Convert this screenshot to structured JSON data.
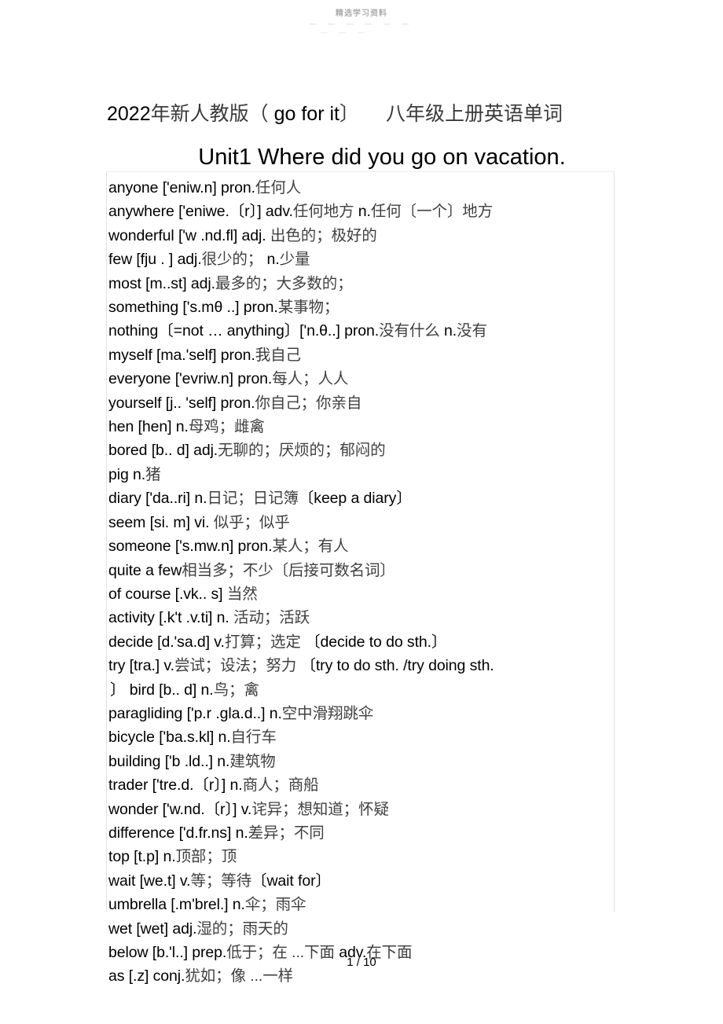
{
  "watermark": {
    "text": "精选学习资料",
    "dashes_row1": "—  —  —  —  —  —",
    "dashes_row2": "—  —  —"
  },
  "heading": {
    "title_prefix": "2022",
    "title_cn_1": "年新人教版（",
    "title_en": " go for it",
    "title_cn_2": "〕",
    "title_cn_3": "八年级上册英语单词",
    "unit_title": "Unit1  Where did you go on vacation."
  },
  "vocabulary": [
    {
      "en": "anyone ['eniw.n] pron.",
      "cn": "任何人"
    },
    {
      "en": "anywhere ['eniwe.〔r〕] adv.",
      "cn": "任何地方",
      "en2": " n.",
      "cn2": "任何〔一个〕地方"
    },
    {
      "en": "wonderful ['w .nd.fl] adj. ",
      "cn": "出色的；极好的"
    },
    {
      "en": "few [fju . ] adj.",
      "cn": "很少的；",
      "en2": " n.",
      "cn2": "少量"
    },
    {
      "en": "most [m..st] adj.",
      "cn": "最多的；大多数的；"
    },
    {
      "en": "something ['s.mθ ..] pron.",
      "cn": "某事物；"
    },
    {
      "en": "nothing〔=not … anything〕['n.θ..]   pron.",
      "cn": "没有什么",
      "en2": " n.",
      "cn2": "没有"
    },
    {
      "en": "myself [ma.'self] pron.",
      "cn": "我自己"
    },
    {
      "en": "everyone ['evriw.n] pron.",
      "cn": "每人；人人"
    },
    {
      "en": "yourself [j.. 'self] pron.",
      "cn": "你自己；你亲自"
    },
    {
      "en": "hen [hen] n.",
      "cn": "母鸡；雌禽"
    },
    {
      "en": "bored [b.. d] adj.",
      "cn": "无聊的；厌烦的；郁闷的"
    },
    {
      "en": "pig n.",
      "cn": "猪"
    },
    {
      "en": "diary ['da..ri] n.",
      "cn": "日记；日记簿",
      "en2": "〔keep a diary〕"
    },
    {
      "en": "seem [si. m] vi. ",
      "cn": "似乎；似乎"
    },
    {
      "en": "someone ['s.mw.n] pron.",
      "cn": "某人；有人"
    },
    {
      "en": "quite a few",
      "cn": "相当多；不少〔后接可数名词〕"
    },
    {
      "en": "of course [.vk.. s] ",
      "cn": "当然"
    },
    {
      "en": "activity [.k't .v.ti] n. ",
      "cn": "活动；活跃"
    },
    {
      "en": "decide [d.'sa.d] v.",
      "cn": "打算；选定",
      "en2": " 〔decide to do sth.〕"
    },
    {
      "en": "try [tra.] v.",
      "cn": "尝试；设法；努力",
      "en2": "  〔try to do sth. /try doing sth."
    },
    {
      "en": "〕 bird [b.. d] n.",
      "cn": "鸟；禽",
      "indent": true
    },
    {
      "en": "paragliding ['p.r .gla.d..] n.",
      "cn": "空中滑翔跳伞"
    },
    {
      "en": "bicycle ['ba.s.kl] n.",
      "cn": "自行车"
    },
    {
      "en": "building ['b .ld..] n.",
      "cn": "建筑物"
    },
    {
      "en": "trader ['tre.d.〔r〕] n.",
      "cn": "商人；商船"
    },
    {
      "en": "wonder ['w.nd.〔r〕] v.",
      "cn": "诧异；想知道；怀疑"
    },
    {
      "en": "difference ['d.fr.ns] n.",
      "cn": "差异；不同"
    },
    {
      "en": "top [t.p] n.",
      "cn": "顶部；顶"
    },
    {
      "en": "wait [we.t] v.",
      "cn": "等；等待",
      "en2": "〔wait for〕"
    },
    {
      "en": "umbrella [.m'brel.] n.",
      "cn": "伞；雨伞"
    },
    {
      "en": "wet [wet] adj.",
      "cn": "湿的；雨天的"
    },
    {
      "en": "below [b.'l..] prep.",
      "cn": "低于；在 ...下面",
      "en2": " adv.",
      "cn2": "在下面"
    },
    {
      "en": "as [.z] conj.",
      "cn": "犹如；像 ...一样"
    }
  ],
  "footer": {
    "page_number": "1 / 10"
  }
}
